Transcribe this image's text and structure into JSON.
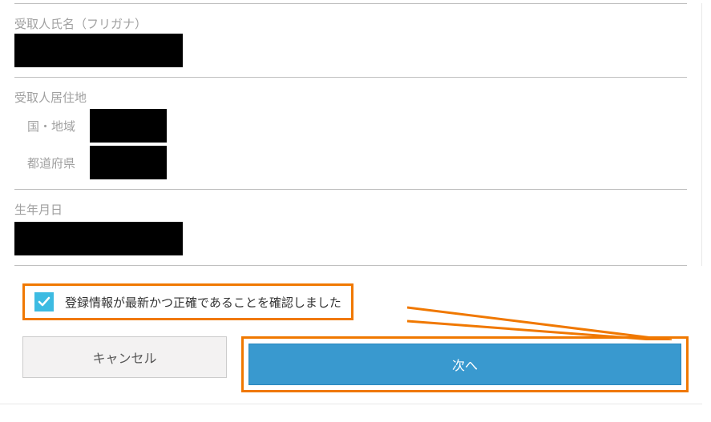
{
  "form": {
    "furigana": {
      "label": "受取人氏名（フリガナ）",
      "value": "　"
    },
    "residence": {
      "label": "受取人居住地",
      "country_label": "国・地域",
      "country_value": "　",
      "prefecture_label": "都道府県",
      "prefecture_value": "　"
    },
    "dob": {
      "label": "生年月日",
      "value": "　"
    }
  },
  "confirm": {
    "checkbox_label": "登録情報が最新かつ正確であることを確認しました",
    "checked": true
  },
  "buttons": {
    "cancel": "キャンセル",
    "next": "次へ"
  },
  "highlight_color": "#f07800",
  "primary_color": "#3999cf",
  "checkbox_color": "#3dbbe2"
}
